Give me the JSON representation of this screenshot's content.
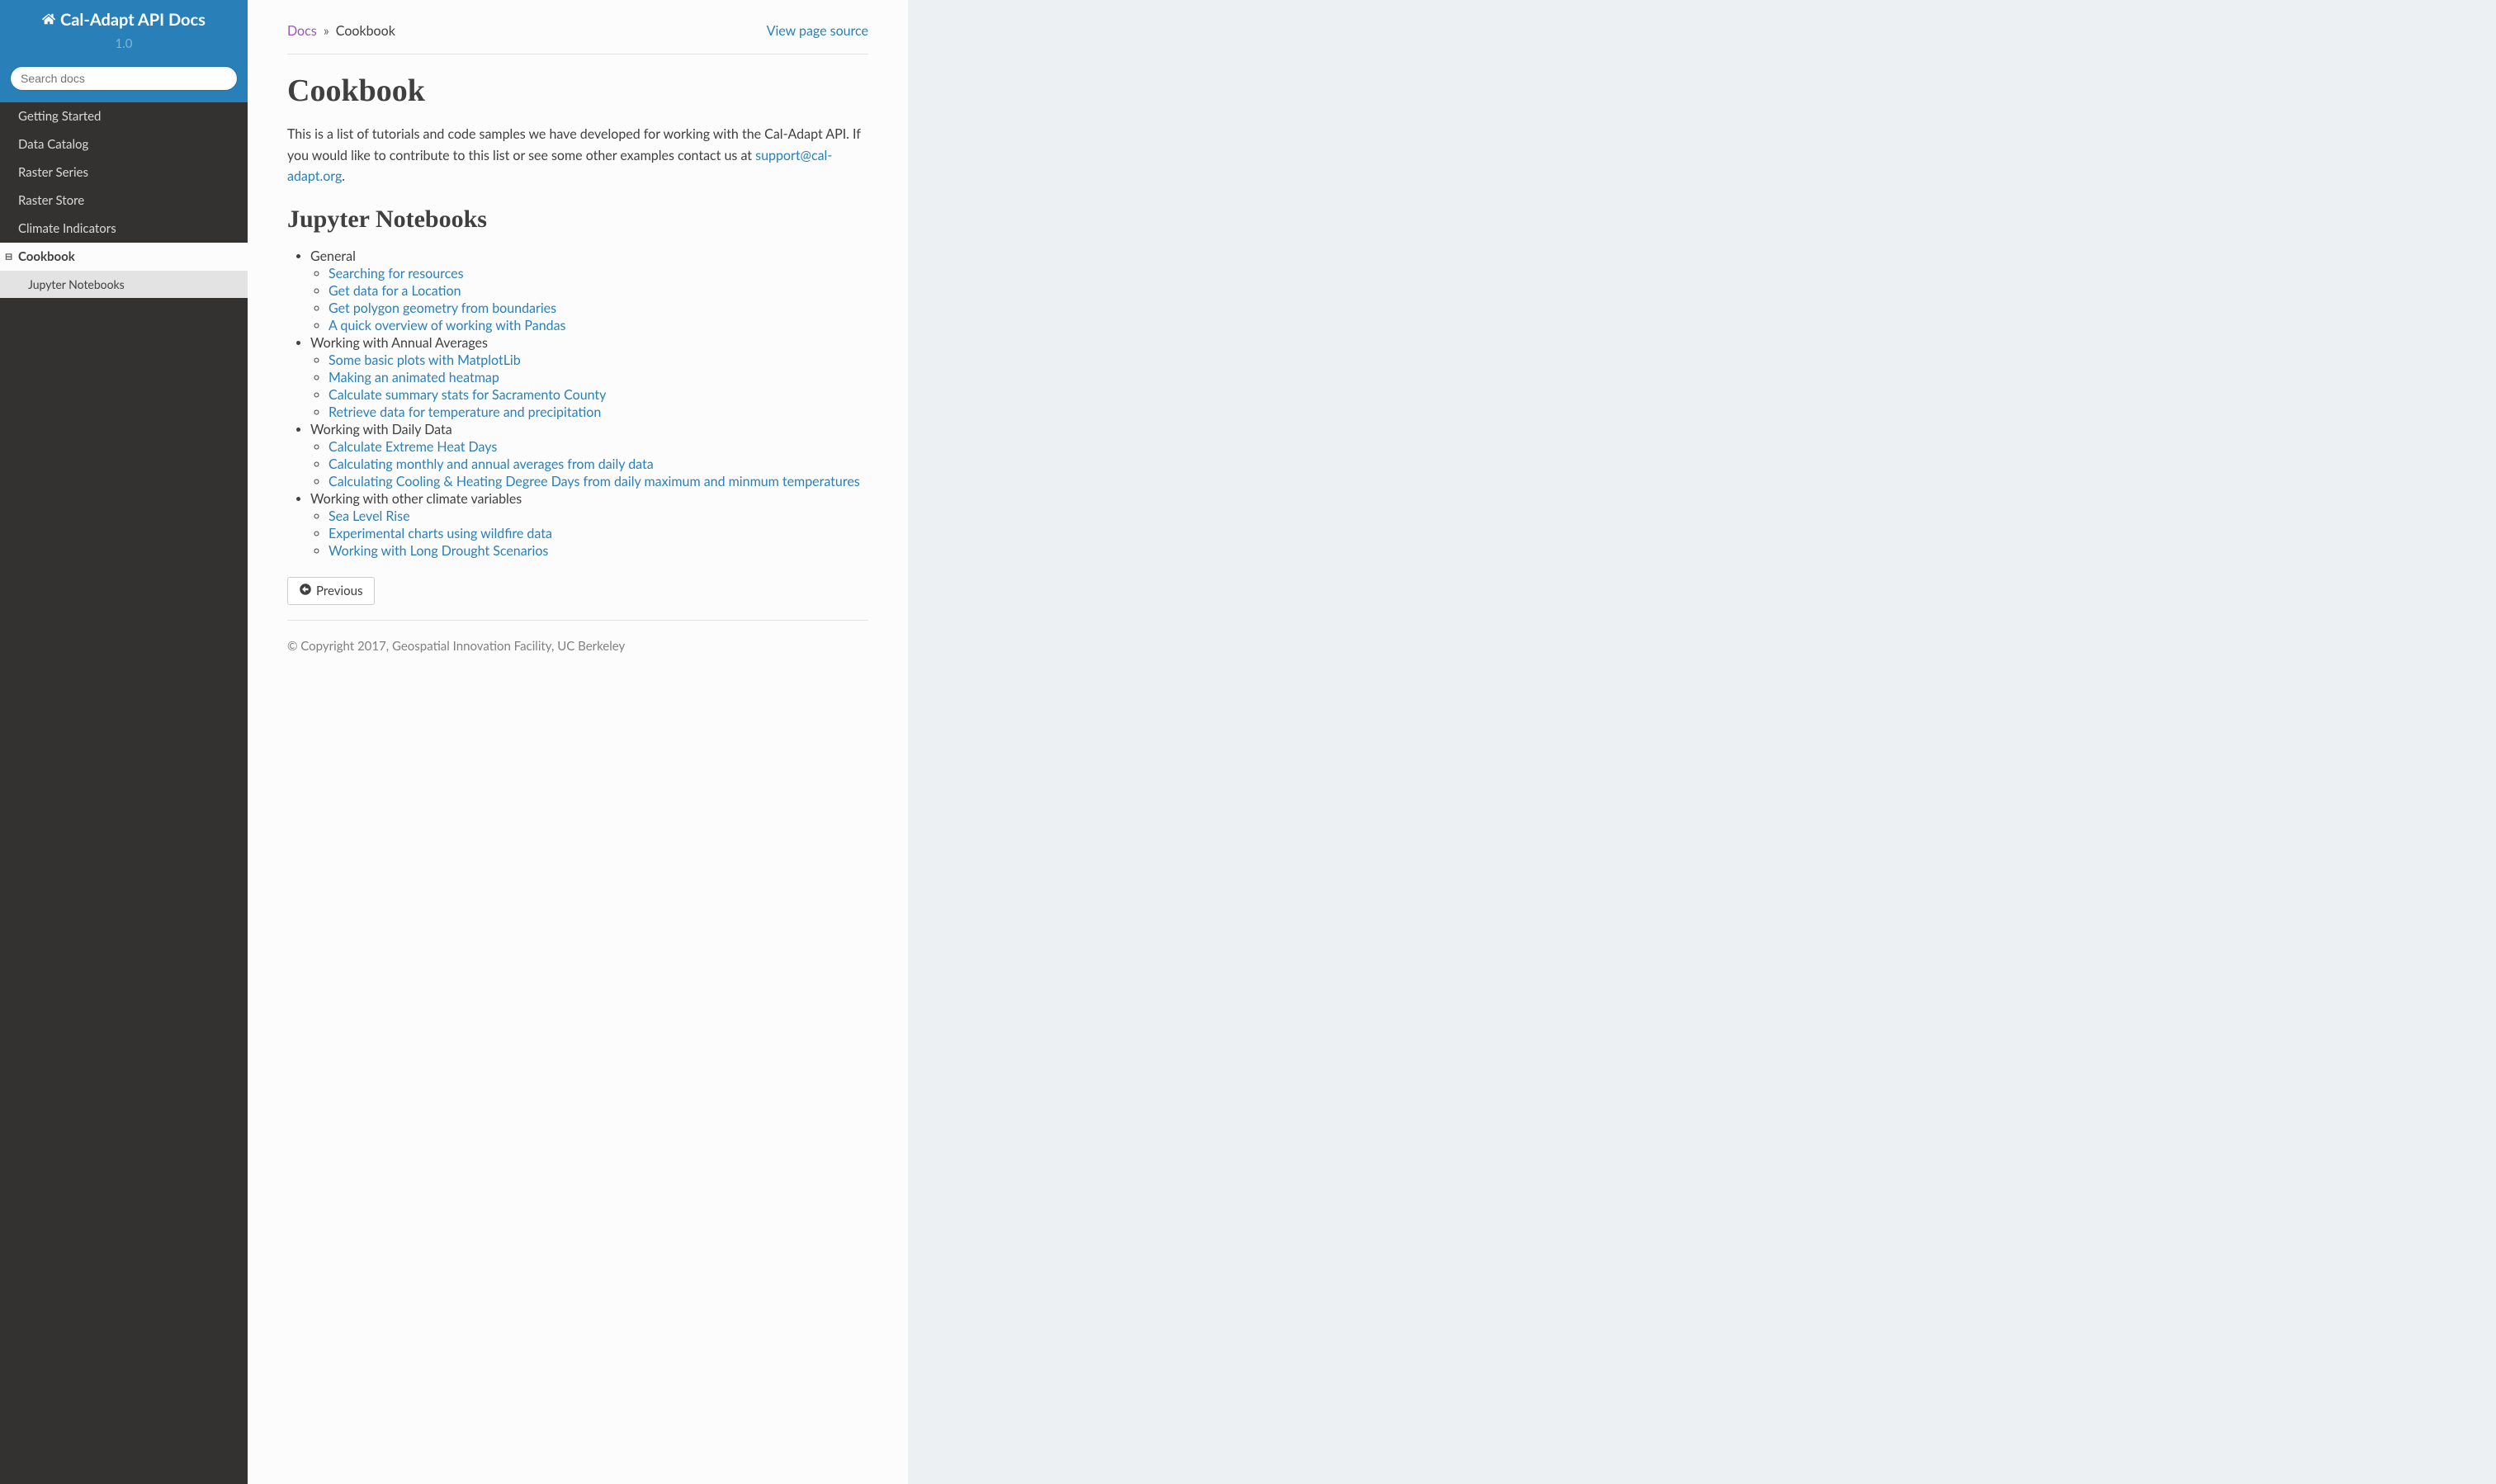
{
  "sidebar": {
    "title": "Cal-Adapt API Docs",
    "version": "1.0",
    "search_placeholder": "Search docs",
    "nav": [
      {
        "label": "Getting Started"
      },
      {
        "label": "Data Catalog"
      },
      {
        "label": "Raster Series"
      },
      {
        "label": "Raster Store"
      },
      {
        "label": "Climate Indicators"
      }
    ],
    "current": {
      "label": "Cookbook",
      "children": [
        {
          "label": "Jupyter Notebooks"
        }
      ]
    }
  },
  "breadcrumb": {
    "root": "Docs",
    "sep": "»",
    "page": "Cookbook",
    "view_source": "View page source"
  },
  "page": {
    "title": "Cookbook",
    "intro_before": "This is a list of tutorials and code samples we have developed for working with the Cal-Adapt API. If you would like to contribute to this list or see some other examples contact us at ",
    "intro_link": "support@cal-adapt.org",
    "intro_after": ".",
    "section_title": "Jupyter Notebooks",
    "notebooks": [
      {
        "category": "General",
        "links": [
          "Searching for resources",
          "Get data for a Location",
          "Get polygon geometry from boundaries",
          "A quick overview of working with Pandas"
        ]
      },
      {
        "category": "Working with Annual Averages",
        "links": [
          "Some basic plots with MatplotLib",
          "Making an animated heatmap",
          "Calculate summary stats for Sacramento County",
          "Retrieve data for temperature and precipitation"
        ]
      },
      {
        "category": "Working with Daily Data",
        "links": [
          "Calculate Extreme Heat Days",
          "Calculating monthly and annual averages from daily data",
          "Calculating Cooling & Heating Degree Days from daily maximum and minmum temperatures"
        ]
      },
      {
        "category": "Working with other climate variables",
        "links": [
          "Sea Level Rise",
          "Experimental charts using wildfire data",
          "Working with Long Drought Scenarios"
        ]
      }
    ],
    "prev_label": "Previous",
    "copyright": "© Copyright 2017, Geospatial Innovation Facility, UC Berkeley"
  }
}
